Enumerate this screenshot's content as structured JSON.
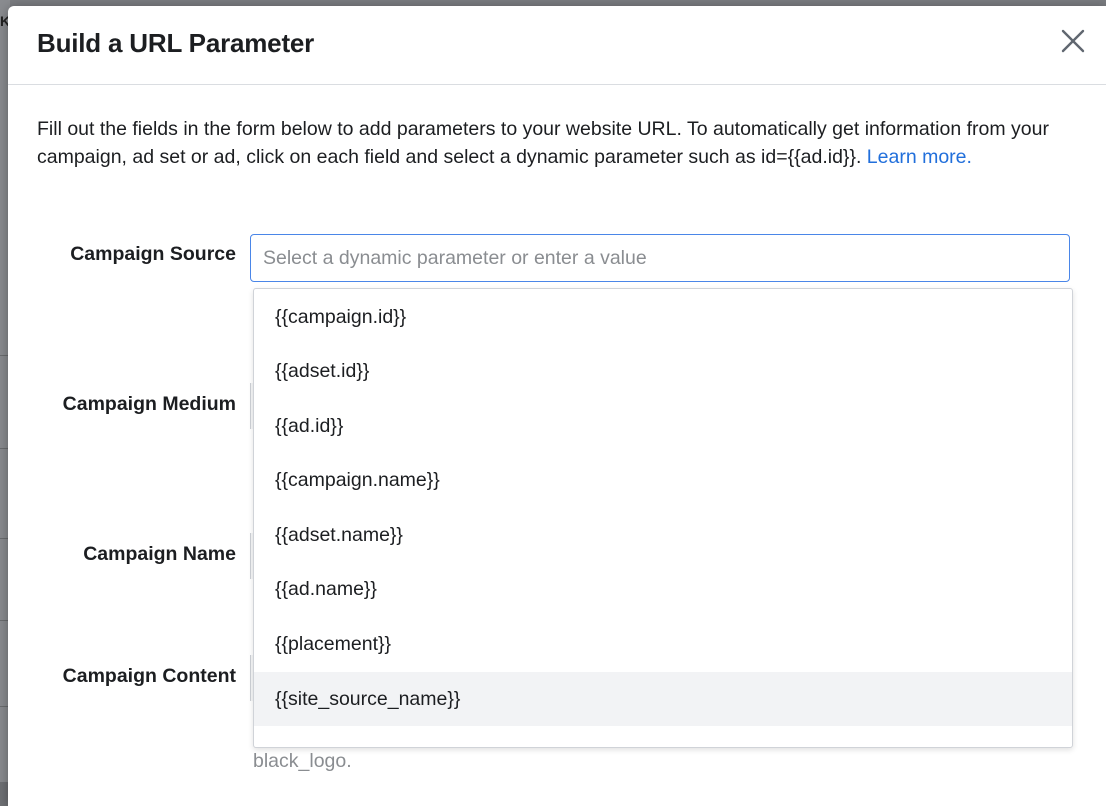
{
  "dialog": {
    "title": "Build a URL Parameter",
    "close_label": "Close"
  },
  "intro": {
    "text": "Fill out the fields in the form below to add parameters to your website URL. To automatically get information from your campaign, ad set or ad, click on each field and select a dynamic parameter such as id={{ad.id}}.",
    "link": "Learn more."
  },
  "fields": {
    "source_label": "Campaign Source",
    "medium_label": "Campaign Medium",
    "name_label": "Campaign Name",
    "content_label": "Campaign Content"
  },
  "source_input": {
    "placeholder": "Select a dynamic parameter or enter a value",
    "value": ""
  },
  "dropdown": {
    "options": [
      "{{campaign.id}}",
      "{{adset.id}}",
      "{{ad.id}}",
      "{{campaign.name}}",
      "{{adset.name}}",
      "{{ad.name}}",
      "{{placement}}",
      "{{site_source_name}}"
    ],
    "hovered_index": 7
  },
  "below_text": "black_logo.",
  "colors": {
    "link": "#216fdb",
    "focus_border": "#4a86e8",
    "text": "#1c1e21",
    "placeholder": "#8a8d91",
    "hover_bg": "#f2f3f5"
  },
  "icons": {
    "close": "close-icon"
  }
}
